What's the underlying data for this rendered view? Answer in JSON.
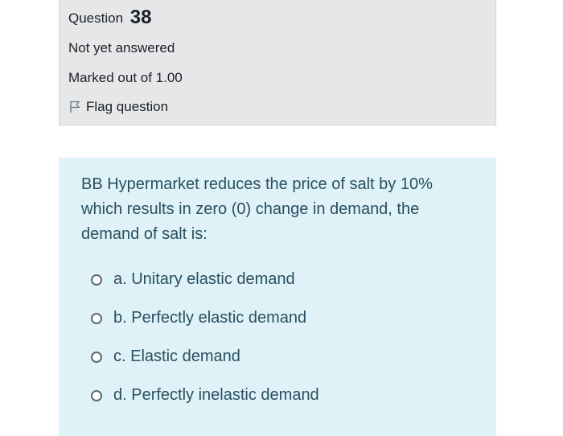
{
  "info": {
    "question_prefix": "Question",
    "question_number": "38",
    "state": "Not yet answered",
    "grade": "Marked out of 1.00",
    "flag_label": "Flag question",
    "flag_icon": "flag-outline-icon"
  },
  "question": {
    "text": "BB Hypermarket reduces the price of salt by 10% which results in zero (0) change in demand, the demand of salt is:"
  },
  "answers": [
    {
      "label": "a. Unitary elastic demand",
      "selected": false
    },
    {
      "label": "b. Perfectly elastic demand",
      "selected": false
    },
    {
      "label": "c. Elastic demand",
      "selected": false
    },
    {
      "label": "d. Perfectly inelastic demand",
      "selected": false
    }
  ],
  "colors": {
    "info_background": "#e6e7e9",
    "content_background": "#def2f8",
    "content_text": "#2a4f5f"
  }
}
